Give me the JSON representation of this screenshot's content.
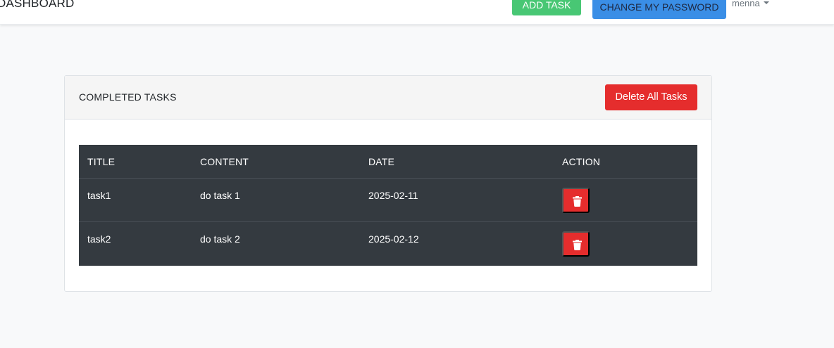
{
  "navbar": {
    "brand": "DASHBOARD",
    "add_task_label": "ADD TASK",
    "change_password_label": "CHANGE MY PASSWORD",
    "user_name": "menna",
    "user_menu_icon": "caret-down-icon",
    "add_task_color": "#48c774",
    "change_password_color": "#3a8ee6"
  },
  "card": {
    "title": "COMPLETED TASKS",
    "delete_all_label": "Delete All Tasks",
    "delete_color": "#e52d2d"
  },
  "table": {
    "columns": [
      "TITLE",
      "CONTENT",
      "DATE",
      "ACTION"
    ],
    "rows": [
      {
        "title": "task1",
        "content": "do task 1",
        "date": "2025-02-11",
        "action_icon": "trash-icon"
      },
      {
        "title": "task2",
        "content": "do task 2",
        "date": "2025-02-12",
        "action_icon": "trash-icon"
      }
    ],
    "background_color": "#343a40"
  }
}
